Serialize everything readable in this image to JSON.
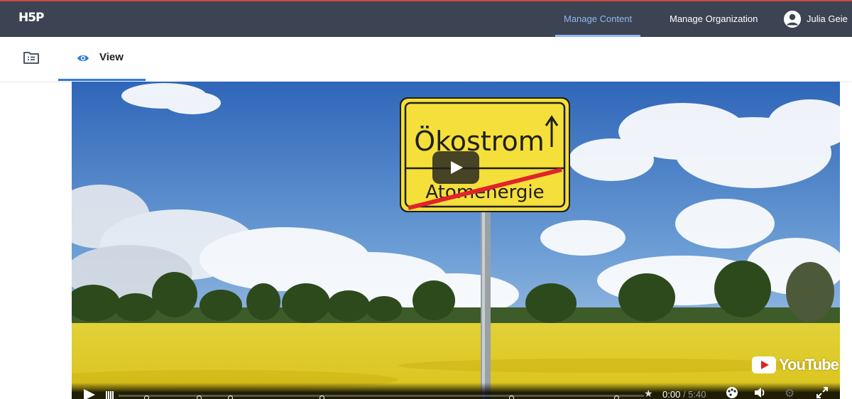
{
  "app": {
    "logo_text": "H5P"
  },
  "nav": {
    "items": [
      {
        "label": "Manage Content",
        "active": true
      },
      {
        "label": "Manage Organization",
        "active": false
      }
    ],
    "user": {
      "name": "Julia Geie",
      "icon": "user-avatar-icon"
    }
  },
  "toolbar": {
    "folder_icon": "folder-list-icon",
    "tabs": [
      {
        "label": "View",
        "icon": "eye-icon",
        "active": true
      }
    ]
  },
  "video": {
    "sign_top": "Ökostrom",
    "sign_bottom": "Atomenergie",
    "provider_label": "YouTube",
    "current_time": "0:00",
    "total_time": "5:40",
    "progress_fraction": 0.0,
    "controls": [
      "play-icon",
      "bookmarks-icon",
      "star-icon",
      "quality-icon",
      "volume-icon",
      "settings-icon",
      "fullscreen-icon"
    ]
  },
  "colors": {
    "topbar_bg": "#3c4353",
    "active_nav": "#8fb7ee",
    "tab_accent": "#2f7bdb",
    "sign_yellow": "#f5df3a",
    "strike_red": "#e0242a"
  }
}
